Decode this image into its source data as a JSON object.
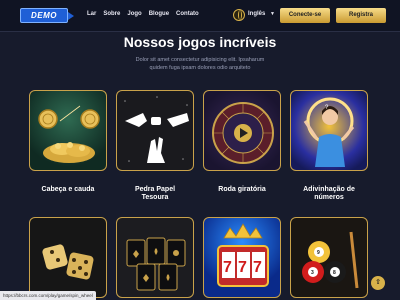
{
  "header": {
    "logo": "DEMO",
    "nav": [
      "Lar",
      "Sobre",
      "Jogo",
      "Blogue",
      "Contato"
    ],
    "language": "Inglês",
    "connect_label": "Conecte-se",
    "register_label": "Registra"
  },
  "hero": {
    "title": "Nossos jogos incríveis",
    "subtitle_line1": "Dolor sit amet consectetur adipisicing elit. Ipsaharum",
    "subtitle_line2": "quidem fuga ipsam dolores odio arquiteto"
  },
  "games": [
    {
      "label": "Cabeça e cauda",
      "icon": "coins-icon"
    },
    {
      "label_line1": "Pedra Papel",
      "label_line2": "Tesoura",
      "icon": "hands-icon"
    },
    {
      "label": "Roda giratória",
      "icon": "wheel-icon"
    },
    {
      "label_line1": "Adivinhação de",
      "label_line2": "números",
      "icon": "person-icon"
    },
    {
      "icon": "dice-icon"
    },
    {
      "icon": "cards-icon"
    },
    {
      "icon": "slot-777-icon"
    },
    {
      "icon": "billiard-icon"
    }
  ],
  "status_url": "https://bbcrs.com.com/play/game/spin_wheel",
  "colors": {
    "background": "#171b2c",
    "gold": "#c9a24a",
    "header": "#101423"
  }
}
